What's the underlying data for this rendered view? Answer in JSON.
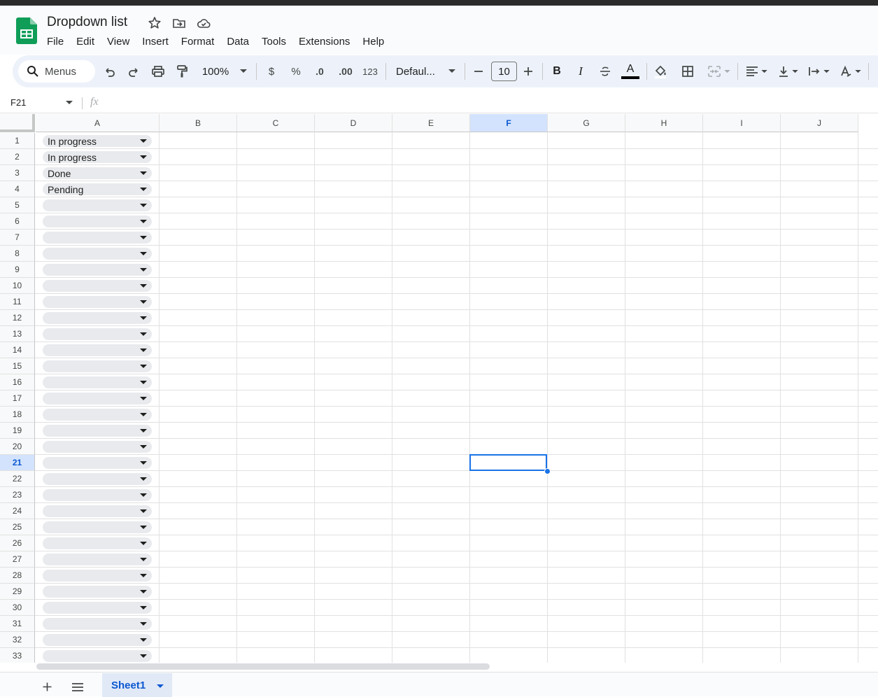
{
  "doc": {
    "title": "Dropdown list"
  },
  "menubar": [
    "File",
    "Edit",
    "View",
    "Insert",
    "Format",
    "Data",
    "Tools",
    "Extensions",
    "Help"
  ],
  "toolbar": {
    "menus_label": "Menus",
    "zoom": "100%",
    "currency": "$",
    "percent": "%",
    "decrease_decimal": ".0",
    "increase_decimal": ".00",
    "number_format": "123",
    "font": "Defaul...",
    "font_size": "10",
    "bold": "B",
    "italic": "I",
    "text_color": "A"
  },
  "formula_bar": {
    "name_box": "F21",
    "fx": "fx"
  },
  "columns": [
    "A",
    "B",
    "C",
    "D",
    "E",
    "F",
    "G",
    "H",
    "I",
    "J"
  ],
  "selected_column": "F",
  "rows": [
    "1",
    "2",
    "3",
    "4",
    "5",
    "6",
    "7",
    "8",
    "9",
    "10",
    "11",
    "12",
    "13",
    "14",
    "15",
    "16",
    "17",
    "18",
    "19",
    "20",
    "21",
    "22",
    "23",
    "24",
    "25",
    "26",
    "27",
    "28",
    "29",
    "30",
    "31",
    "32",
    "33"
  ],
  "selected_row": "21",
  "column_a_values": [
    "In progress",
    "In progress",
    "Done",
    "Pending",
    "",
    "",
    "",
    "",
    "",
    "",
    "",
    "",
    "",
    "",
    "",
    "",
    "",
    "",
    "",
    "",
    "",
    "",
    "",
    "",
    "",
    "",
    "",
    "",
    "",
    "",
    "",
    "",
    ""
  ],
  "sheets": [
    {
      "name": "Sheet1",
      "active": true
    }
  ],
  "colors": {
    "accent": "#1a73e8",
    "selected_header": "#d3e3fd",
    "chip_bg": "#e8eaed",
    "logo_green": "#0f9d58"
  },
  "icons": [
    "search-icon",
    "undo-icon",
    "redo-icon",
    "print-icon",
    "paint-format-icon",
    "star-icon",
    "move-folder-icon",
    "cloud-icon",
    "fill-color-icon",
    "borders-icon",
    "merge-icon",
    "align-icon",
    "valign-icon",
    "wrap-icon",
    "rotate-icon",
    "strikethrough-icon"
  ]
}
